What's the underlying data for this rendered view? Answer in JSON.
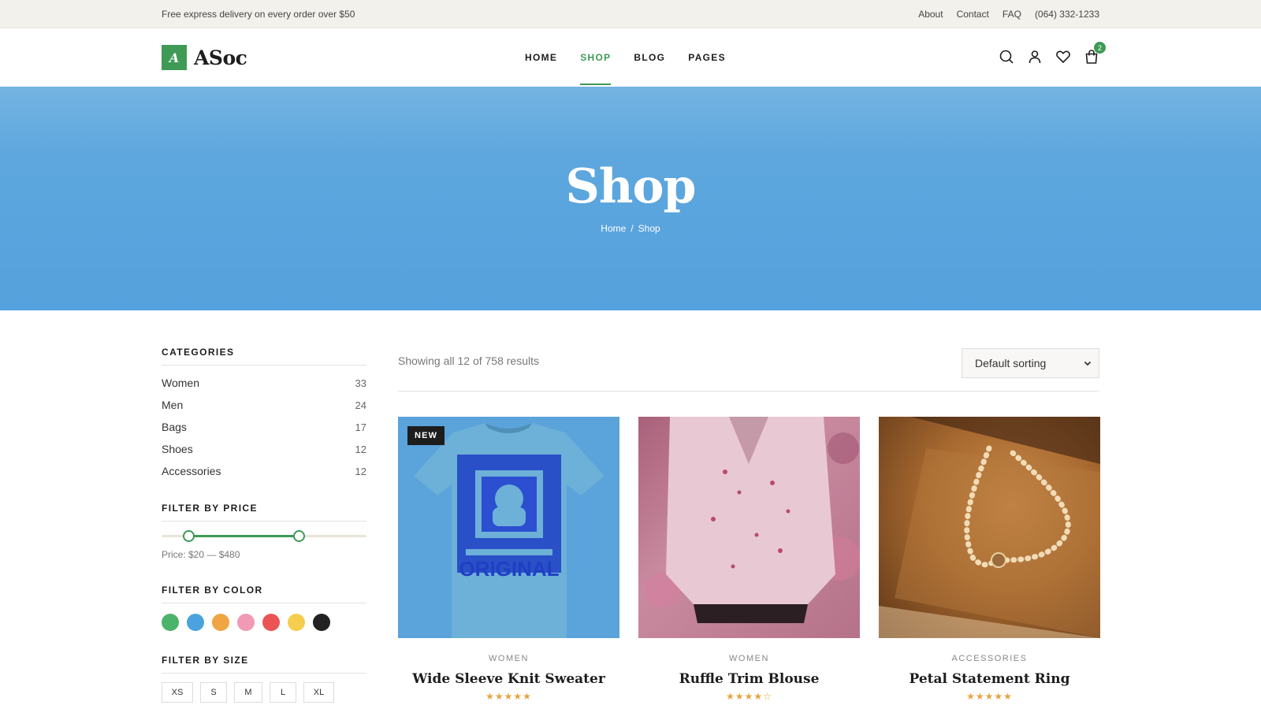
{
  "topbar": {
    "promo": "Free express delivery on every order over $50",
    "links": [
      "About",
      "Contact",
      "FAQ",
      "(064) 332-1233"
    ]
  },
  "header": {
    "logo_mark": "A",
    "logo_name": "ASoc",
    "nav": [
      {
        "label": "HOME",
        "active": false
      },
      {
        "label": "SHOP",
        "active": true
      },
      {
        "label": "BLOG",
        "active": false
      },
      {
        "label": "PAGES",
        "active": false
      }
    ],
    "icons": [
      "search-icon",
      "user-icon",
      "heart-icon",
      "cart-icon"
    ],
    "cart_count": "2",
    "accent": "#3e9a55"
  },
  "hero": {
    "title": "Shop",
    "breadcrumb": [
      "Home",
      "/",
      "Shop"
    ]
  },
  "sidebar": {
    "categories_title": "CATEGORIES",
    "categories": [
      {
        "name": "Women",
        "count": "33"
      },
      {
        "name": "Men",
        "count": "24"
      },
      {
        "name": "Bags",
        "count": "17"
      },
      {
        "name": "Shoes",
        "count": "12"
      },
      {
        "name": "Accessories",
        "count": "12"
      }
    ],
    "price_title": "FILTER BY PRICE",
    "price_label": "Price: $20 — $480",
    "price_range": {
      "min_pct": 13,
      "max_pct": 67
    },
    "color_title": "FILTER BY COLOR",
    "colors": [
      "#4cb36a",
      "#4aa3de",
      "#efa542",
      "#f09ab5",
      "#ea5454",
      "#f5cd4f",
      "#222222"
    ],
    "size_title": "FILTER BY SIZE",
    "sizes": [
      "XS",
      "S",
      "M",
      "L",
      "XL"
    ]
  },
  "main": {
    "results_text": "Showing all 12 of 758 results",
    "sort_label": "Default sorting",
    "products": [
      {
        "category": "WOMEN",
        "name": "Wide Sleeve Knit Sweater",
        "rating": 5,
        "badge": "NEW"
      },
      {
        "category": "WOMEN",
        "name": "Ruffle Trim Blouse",
        "rating": 4,
        "badge": ""
      },
      {
        "category": "ACCESSORIES",
        "name": "Petal Statement Ring",
        "rating": 5,
        "badge": ""
      }
    ],
    "image_texts": {
      "shirt_print": "ORIGINAL"
    }
  }
}
